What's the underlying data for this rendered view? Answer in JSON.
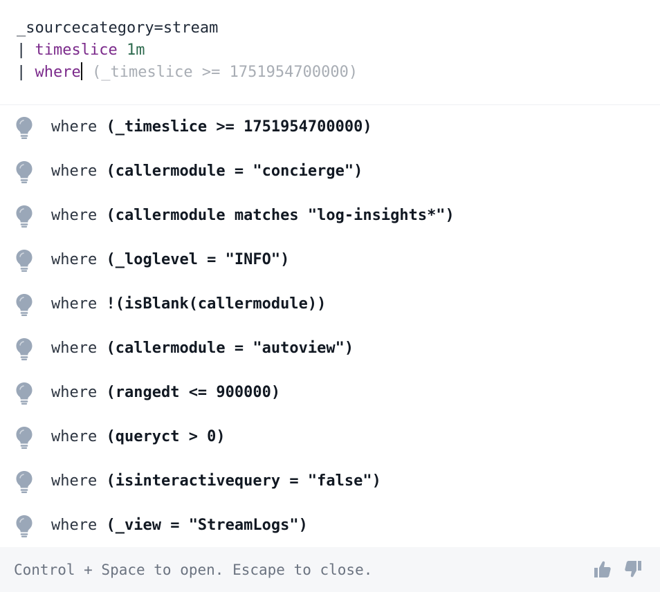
{
  "editor": {
    "line1": "_sourcecategory=stream",
    "line2_pipe": "| ",
    "line2_kw": "timeslice",
    "line2_num": " 1m",
    "line3_pipe": "| ",
    "line3_kw": "where",
    "line3_ghost": " (_timeslice >= 1751954700000)"
  },
  "suggestions": [
    {
      "prefix": "where ",
      "body": "(_timeslice >= 1751954700000)"
    },
    {
      "prefix": "where ",
      "body": "(callermodule = \"concierge\")"
    },
    {
      "prefix": "where ",
      "body": "(callermodule matches \"log-insights*\")"
    },
    {
      "prefix": "where ",
      "body": "(_loglevel = \"INFO\")"
    },
    {
      "prefix": "where ",
      "body": "!(isBlank(callermodule))"
    },
    {
      "prefix": "where ",
      "body": "(callermodule = \"autoview\")"
    },
    {
      "prefix": "where ",
      "body": "(rangedt <= 900000)"
    },
    {
      "prefix": "where ",
      "body": "(queryct > 0)"
    },
    {
      "prefix": "where ",
      "body": "(isinteractivequery = \"false\")"
    },
    {
      "prefix": "where ",
      "body": "(_view = \"StreamLogs\")"
    }
  ],
  "suggestion_icon": "lightbulb-icon",
  "footer": {
    "hint": "Control + Space to open. Escape to close.",
    "thumbs_up_icon": "thumbs-up-icon",
    "thumbs_down_icon": "thumbs-down-icon"
  },
  "colors": {
    "keyword": "#7b2a8b",
    "number": "#2e6b4f",
    "ghost_text": "#a8adb4",
    "icon": "#9aa7b8",
    "footer_bg": "#f6f7f9"
  }
}
